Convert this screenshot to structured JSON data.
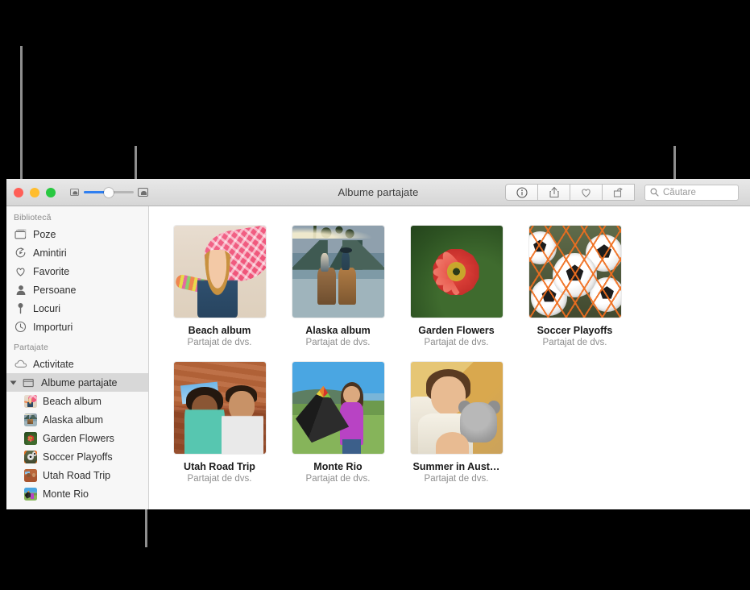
{
  "window": {
    "title": "Albume partajate",
    "traffic_lights": [
      "close",
      "minimize",
      "zoom"
    ],
    "zoom_slider": {
      "value_percent": 50,
      "small_icon": "small-thumbnail-icon",
      "large_icon": "large-thumbnail-icon"
    }
  },
  "toolbar": {
    "buttons": [
      {
        "name": "info",
        "icon": "info-circle-icon"
      },
      {
        "name": "share",
        "icon": "share-icon"
      },
      {
        "name": "favorite",
        "icon": "heart-icon"
      },
      {
        "name": "rotate",
        "icon": "rotate-icon"
      }
    ],
    "search": {
      "placeholder": "Căutare",
      "value": "",
      "icon": "search-icon"
    }
  },
  "sidebar": {
    "sections": [
      {
        "label": "Bibliotecă",
        "items": [
          {
            "label": "Poze",
            "icon": "photos-icon"
          },
          {
            "label": "Amintiri",
            "icon": "memories-icon"
          },
          {
            "label": "Favorite",
            "icon": "heart-icon"
          },
          {
            "label": "Persoane",
            "icon": "person-icon"
          },
          {
            "label": "Locuri",
            "icon": "pin-icon"
          },
          {
            "label": "Importuri",
            "icon": "clock-icon"
          }
        ]
      },
      {
        "label": "Partajate",
        "items": [
          {
            "label": "Activitate",
            "icon": "cloud-icon"
          },
          {
            "label": "Albume partajate",
            "icon": "shared-album-icon",
            "selected": true,
            "expanded": true
          }
        ],
        "children": [
          {
            "label": "Beach album",
            "thumb": "beach"
          },
          {
            "label": "Alaska album",
            "thumb": "alaska"
          },
          {
            "label": "Garden Flowers",
            "thumb": "garden"
          },
          {
            "label": "Soccer Playoffs",
            "thumb": "soccer"
          },
          {
            "label": "Utah Road Trip",
            "thumb": "utah"
          },
          {
            "label": "Monte Rio",
            "thumb": "monte"
          }
        ]
      }
    ]
  },
  "content": {
    "albums": [
      {
        "title": "Beach album",
        "subtitle": "Partajat de dvs.",
        "thumb": "beach"
      },
      {
        "title": "Alaska album",
        "subtitle": "Partajat de dvs.",
        "thumb": "alaska"
      },
      {
        "title": "Garden Flowers",
        "subtitle": "Partajat de dvs.",
        "thumb": "garden"
      },
      {
        "title": "Soccer Playoffs",
        "subtitle": "Partajat de dvs.",
        "thumb": "soccer"
      },
      {
        "title": "Utah Road Trip",
        "subtitle": "Partajat de dvs.",
        "thumb": "utah"
      },
      {
        "title": "Monte Rio",
        "subtitle": "Partajat de dvs.",
        "thumb": "monte"
      },
      {
        "title": "Summer in Aust…",
        "subtitle": "Partajat de dvs.",
        "thumb": "summer"
      }
    ]
  },
  "colors": {
    "accent": "#2f7ff0",
    "selection": "#d8d8d8",
    "callout": "#8e8e8e",
    "background": "#000000"
  }
}
